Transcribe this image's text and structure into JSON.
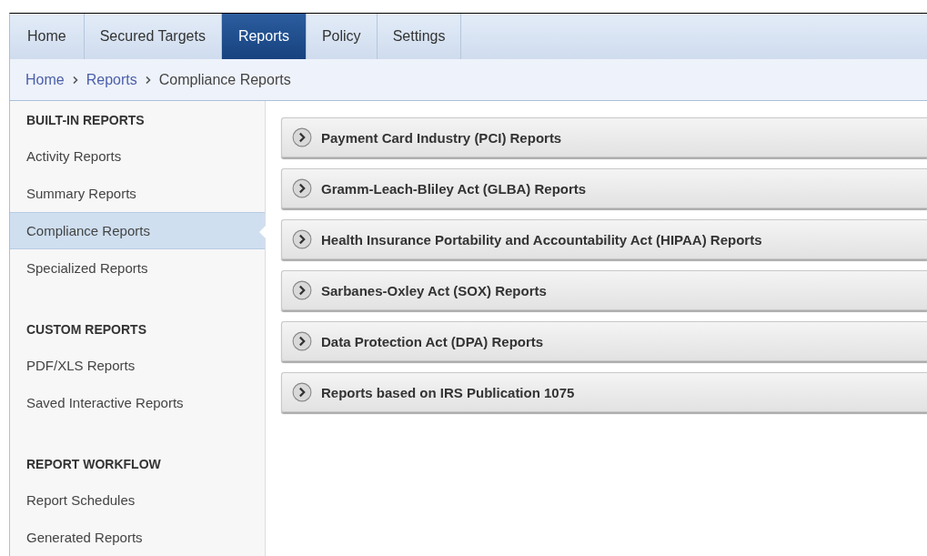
{
  "tabs": [
    {
      "label": "Home",
      "selected": false
    },
    {
      "label": "Secured Targets",
      "selected": false
    },
    {
      "label": "Reports",
      "selected": true
    },
    {
      "label": "Policy",
      "selected": false
    },
    {
      "label": "Settings",
      "selected": false
    }
  ],
  "breadcrumb": [
    {
      "label": "Home",
      "kind": "link"
    },
    {
      "label": "Reports",
      "kind": "link"
    },
    {
      "label": "Compliance Reports",
      "kind": "current"
    }
  ],
  "sidebar": {
    "sections": [
      {
        "heading": "BUILT-IN REPORTS",
        "items": [
          {
            "label": "Activity Reports",
            "selected": false
          },
          {
            "label": "Summary Reports",
            "selected": false
          },
          {
            "label": "Compliance Reports",
            "selected": true
          },
          {
            "label": "Specialized Reports",
            "selected": false
          }
        ]
      },
      {
        "heading": "CUSTOM REPORTS",
        "items": [
          {
            "label": "PDF/XLS Reports",
            "selected": false
          },
          {
            "label": "Saved Interactive Reports",
            "selected": false
          }
        ]
      },
      {
        "heading": "REPORT WORKFLOW",
        "items": [
          {
            "label": "Report Schedules",
            "selected": false
          },
          {
            "label": "Generated Reports",
            "selected": false
          }
        ]
      }
    ]
  },
  "panels": [
    {
      "title": "Payment Card Industry (PCI) Reports",
      "expanded": false
    },
    {
      "title": "Gramm-Leach-Bliley Act (GLBA) Reports",
      "expanded": false
    },
    {
      "title": "Health Insurance Portability and Accountability Act (HIPAA) Reports",
      "expanded": false
    },
    {
      "title": "Sarbanes-Oxley Act (SOX) Reports",
      "expanded": false
    },
    {
      "title": "Data Protection Act (DPA) Reports",
      "expanded": false
    },
    {
      "title": "Reports based on IRS Publication 1075",
      "expanded": false
    }
  ]
}
